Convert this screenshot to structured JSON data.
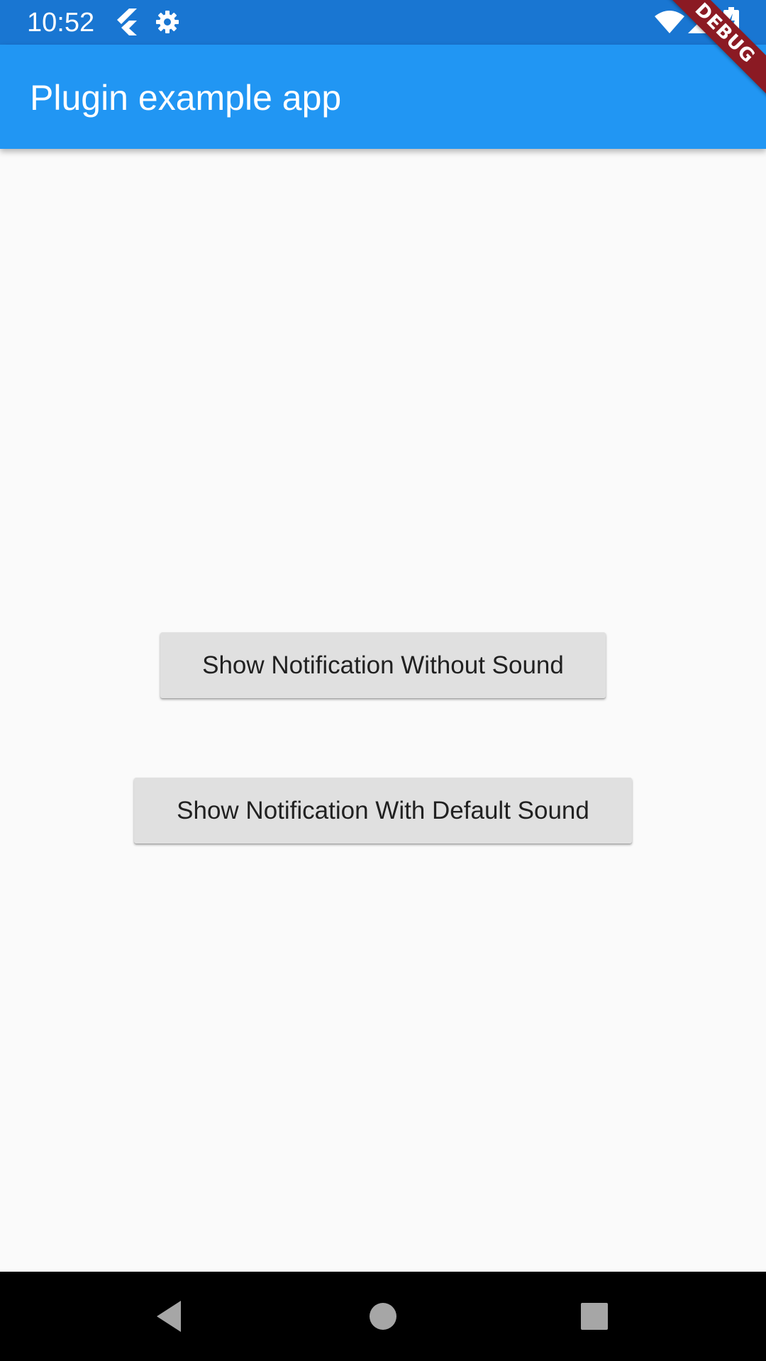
{
  "status_bar": {
    "time": "10:52",
    "icons": [
      "flutter-icon",
      "settings-gear-icon",
      "wifi-icon",
      "cellular-signal-icon",
      "battery-charging-icon"
    ],
    "background": "#1976d2"
  },
  "app_bar": {
    "title": "Plugin example app",
    "background": "#2196f3"
  },
  "debug_banner": {
    "label": "DEBUG",
    "color": "#8b1a23"
  },
  "main": {
    "buttons": [
      {
        "label": "Show Notification Without Sound"
      },
      {
        "label": "Show Notification With Default Sound"
      }
    ],
    "button_background": "#e0e0e0"
  },
  "nav_bar": {
    "icons": [
      "back-triangle-icon",
      "home-circle-icon",
      "recents-square-icon"
    ]
  }
}
